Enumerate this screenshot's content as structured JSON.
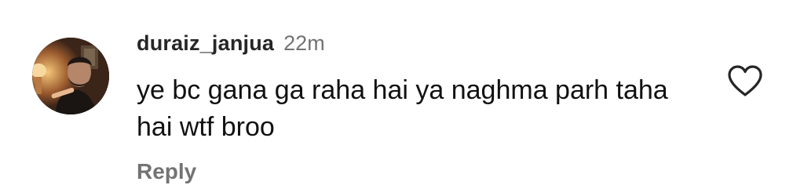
{
  "comment": {
    "username": "duraiz_janjua",
    "timestamp": "22m",
    "text": "ye bc gana ga raha hai ya naghma parh taha hai wtf broo",
    "reply_label": "Reply",
    "like_icon": "heart-outline-icon"
  },
  "colors": {
    "username": "#262626",
    "meta": "#737373",
    "text": "#111111",
    "background": "#ffffff"
  }
}
